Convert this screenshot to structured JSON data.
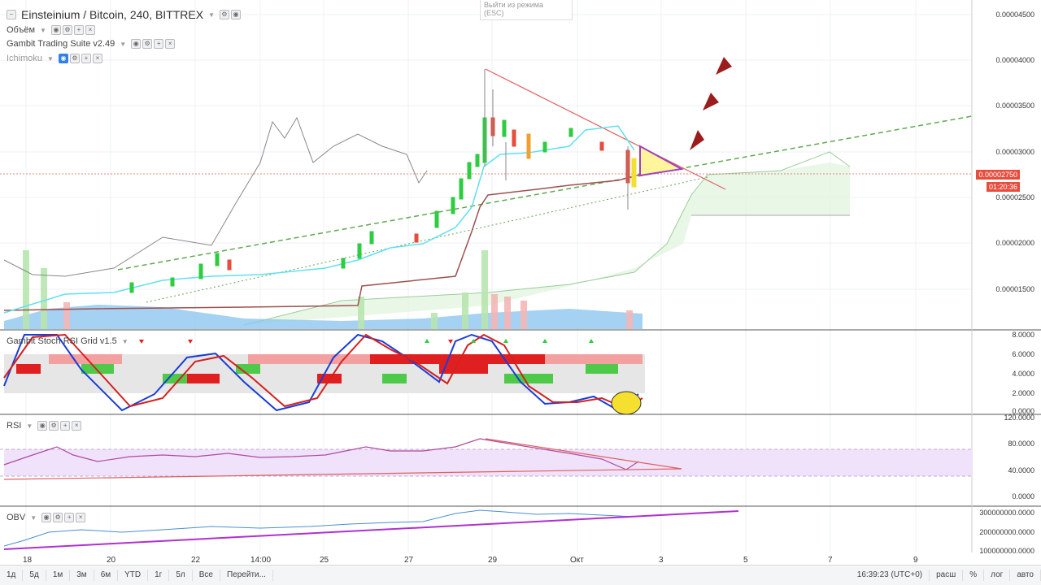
{
  "chart_header": {
    "symbol": "Einsteinium / Bitcoin, 240, BITTREX",
    "indicators": [
      "Объём",
      "Gambit Trading Suite v2.49",
      "Ichimoku"
    ]
  },
  "exit_hint": {
    "line1": "Выйти из режима",
    "line2": "(ESC)"
  },
  "price_axis": [
    "0.00004500",
    "0.00004000",
    "0.00003500",
    "0.00003000",
    "0.00002500",
    "0.00002000",
    "0.00001500"
  ],
  "price_tag": "0.00002750",
  "timer_tag": "01:20:36",
  "panes": {
    "stoch": {
      "label": "Gambit Stoch RSI Grid v1.5",
      "axis": [
        "8.0000",
        "6.0000",
        "4.0000",
        "2.0000",
        "0.0000"
      ]
    },
    "rsi": {
      "label": "RSI",
      "axis": [
        "120.0000",
        "80.0000",
        "40.0000",
        "0.0000"
      ]
    },
    "obv": {
      "label": "OBV",
      "axis": [
        "300000000.0000",
        "200000000.0000",
        "100000000.0000"
      ]
    }
  },
  "time_axis": [
    "18",
    "20",
    "22",
    "14:00",
    "25",
    "27",
    "29",
    "Окт",
    "3",
    "5",
    "7",
    "9"
  ],
  "toolbar": {
    "ranges": [
      "1д",
      "5д",
      "1м",
      "3м",
      "6м",
      "YTD",
      "1г",
      "5л",
      "Все"
    ],
    "goto": "Перейти...",
    "clock": "16:39:23 (UTC+0)",
    "right": [
      "расш",
      "%",
      "лог",
      "авто"
    ]
  },
  "chart_data": {
    "type": "candlestick",
    "title": "Einsteinium / Bitcoin, 240, BITTREX",
    "ylim": [
      1.1e-05,
      4.75e-05
    ],
    "last_price": 2.75e-05,
    "notes": "EMC2/BTC 4h chart with volume, Ichimoku, Stoch RSI grid, RSI and OBV panes"
  },
  "colors": {
    "up": "#2ecc40",
    "down": "#e74c3c",
    "accent": "#2f80ed"
  }
}
